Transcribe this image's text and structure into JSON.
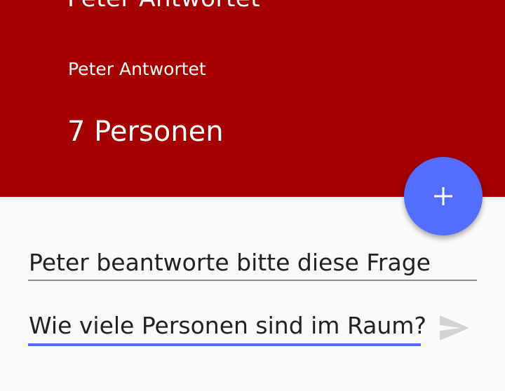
{
  "header": {
    "background_color": "#a50000",
    "clipped_title": "Peter Antwortet",
    "subtitle": "Peter Antwortet",
    "headline": "7 Personen"
  },
  "fab": {
    "icon": "plus-icon",
    "color": "#536dfe"
  },
  "form": {
    "question_field_value": "Peter beantworte bitte diese Frage",
    "answer_field_value": "Wie viele Personen sind im Raum?",
    "accent_color": "#536dfe",
    "send_icon": "send-icon"
  }
}
